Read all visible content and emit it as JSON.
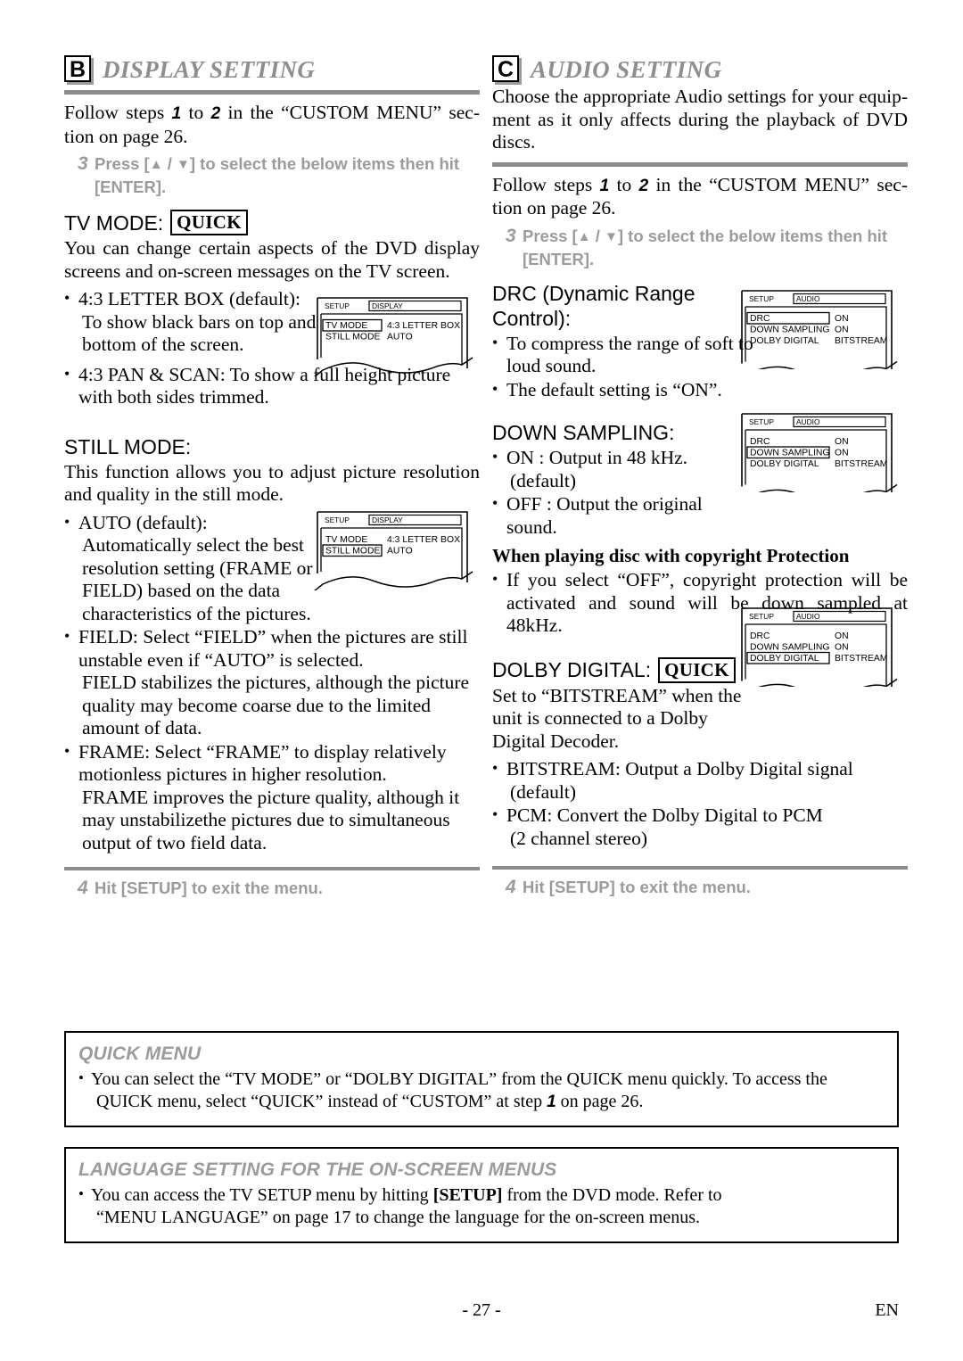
{
  "sections": {
    "display": {
      "badge": "B",
      "title": "DISPLAY SETTING",
      "intro_pre": "Follow steps ",
      "intro_n1": "1",
      "intro_mid": " to ",
      "intro_n2": "2",
      "intro_post": " in the “CUSTOM MENU” sec-tion on page 26.",
      "step3_num": "3",
      "step3_text_a": "Press [",
      "step3_up": "▲",
      "step3_slash": " / ",
      "step3_down": "▼",
      "step3_text_b": "] to select the below items then hit [ENTER].",
      "tv_mode_label": "TV MODE:",
      "tv_mode_tag": "QUICK",
      "tv_mode_body": "You can change certain aspects of the DVD display screens and on-screen messages on the TV screen.",
      "tv_mode_bullets": [
        {
          "main": "4:3 LETTER BOX (default):",
          "sub": "To show black bars on top and bottom of the screen."
        },
        {
          "main": "4:3 PAN & SCAN: To show a full height picture with both sides trimmed.",
          "sub": ""
        }
      ],
      "still_mode_label": "STILL MODE:",
      "still_mode_body": "This function allows you to adjust picture resolution and quality in the still mode.",
      "still_mode_bullets": [
        {
          "main": "AUTO (default):",
          "sub": "Automatically select the best resolution setting (FRAME or FIELD) based on the data characteristics of the pictures."
        },
        {
          "main": "FIELD: Select “FIELD” when the pictures are still unstable even if “AUTO” is selected.",
          "sub": "FIELD stabilizes the pictures, although the picture quality may become coarse due to the limited amount of data."
        },
        {
          "main": "FRAME: Select “FRAME” to display relatively motionless pictures in higher resolution.",
          "sub": "FRAME improves the picture quality, although it may unstabilizethe pictures due to simultaneous output of two field data."
        }
      ],
      "step4_num": "4",
      "step4_text": "Hit [SETUP] to exit the menu."
    },
    "audio": {
      "badge": "C",
      "title": "AUDIO SETTING",
      "lead": "Choose the appropriate Audio settings for your equip-ment as it only affects during the playback of DVD discs.",
      "intro_pre": "Follow steps ",
      "intro_n1": "1",
      "intro_mid": " to ",
      "intro_n2": "2",
      "intro_post": " in the “CUSTOM MENU” sec-tion on page 26.",
      "step3_num": "3",
      "step3_text_a": "Press [",
      "step3_up": "▲",
      "step3_slash": " / ",
      "step3_down": "▼",
      "step3_text_b": "] to select the below items then hit [ENTER].",
      "drc_label": "DRC (Dynamic Range Control):",
      "drc_bullets": [
        "To compress the range of soft to loud sound.",
        "The default setting is “ON”."
      ],
      "down_label": "DOWN SAMPLING:",
      "down_bullets": [
        {
          "main": "ON : Output in 48 kHz.",
          "sub": "(default)"
        },
        {
          "main": "OFF : Output the original sound.",
          "sub": ""
        }
      ],
      "copyright_head": "When playing disc with copyright Protection",
      "copyright_bullet": "If you select “OFF”, copyright protection will be activated and sound will be down sampled at 48kHz.",
      "dolby_label": "DOLBY DIGITAL:",
      "dolby_tag": "QUICK",
      "dolby_body": "Set to “BITSTREAM” when the unit is connected to a Dolby Digital Decoder.",
      "dolby_bullets": [
        {
          "main": "BITSTREAM: Output a Dolby Digital signal",
          "sub": "(default)"
        },
        {
          "main": "PCM: Convert the Dolby Digital to PCM",
          "sub": "(2 channel stereo)"
        }
      ],
      "step4_num": "4",
      "step4_text": "Hit [SETUP] to exit the menu."
    }
  },
  "screens": {
    "display_tvmode": {
      "setup": "SETUP",
      "menu": "DISPLAY",
      "rows": [
        {
          "name": "TV MODE",
          "value": "4:3 LETTER BOX",
          "selected": true
        },
        {
          "name": "STILL MODE",
          "value": "AUTO",
          "selected": false
        }
      ]
    },
    "display_stillmode": {
      "setup": "SETUP",
      "menu": "DISPLAY",
      "rows": [
        {
          "name": "TV MODE",
          "value": "4:3 LETTER BOX",
          "selected": false
        },
        {
          "name": "STILL MODE",
          "value": "AUTO",
          "selected": true
        }
      ]
    },
    "audio_drc": {
      "setup": "SETUP",
      "menu": "AUDIO",
      "rows": [
        {
          "name": "DRC",
          "value": "ON",
          "selected": true
        },
        {
          "name": "DOWN SAMPLING",
          "value": "ON",
          "selected": false
        },
        {
          "name": "DOLBY DIGITAL",
          "value": "BITSTREAM",
          "selected": false
        }
      ]
    },
    "audio_down": {
      "setup": "SETUP",
      "menu": "AUDIO",
      "rows": [
        {
          "name": "DRC",
          "value": "ON",
          "selected": false
        },
        {
          "name": "DOWN SAMPLING",
          "value": "ON",
          "selected": true
        },
        {
          "name": "DOLBY DIGITAL",
          "value": "BITSTREAM",
          "selected": false
        }
      ]
    },
    "audio_dolby": {
      "setup": "SETUP",
      "menu": "AUDIO",
      "rows": [
        {
          "name": "DRC",
          "value": "ON",
          "selected": false
        },
        {
          "name": "DOWN SAMPLING",
          "value": "ON",
          "selected": false
        },
        {
          "name": "DOLBY DIGITAL",
          "value": "BITSTREAM",
          "selected": true
        }
      ]
    }
  },
  "quick_menu_box": {
    "heading": "QUICK MENU",
    "line1": "You can select the “TV MODE” or “DOLBY DIGITAL” from the QUICK menu quickly. To access the",
    "line2_pre": "QUICK menu, select “QUICK” instead of “CUSTOM” at step ",
    "line2_num": "1",
    "line2_post": " on page 26."
  },
  "language_box": {
    "heading": "LANGUAGE SETTING FOR THE ON-SCREEN MENUS",
    "line1_pre": "You can access the TV SETUP menu by hitting ",
    "line1_bold": "[SETUP]",
    "line1_post": " from the DVD mode. Refer to",
    "line2": "“MENU LANGUAGE” on page 17 to change the language for the on-screen menus."
  },
  "footer": {
    "page": "- 27 -",
    "lang": "EN"
  }
}
